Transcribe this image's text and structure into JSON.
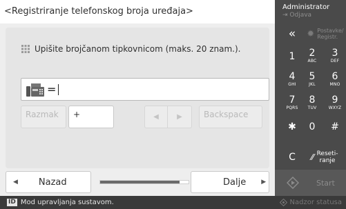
{
  "window": {
    "title": "<Registriranje telefonskog broja uređaja>"
  },
  "instruction": {
    "text": "Upišite brojčanom tipkovnicom (maks. 20 znam.)."
  },
  "number_field": {
    "prefix": "=",
    "value": ""
  },
  "keys": {
    "space_label": "Razmak",
    "plus_label": "+",
    "backspace_label": "Backspace"
  },
  "navigation": {
    "back_label": "Nazad",
    "next_label": "Dalje",
    "progress_fraction": 0.9
  },
  "sidebar": {
    "admin_label": "Administrator",
    "logout_label": "Odjava",
    "settings_label_line1": "Postavke/",
    "settings_label_line2": "Registr.",
    "reset_label_line1": "Reseti-",
    "reset_label_line2": "ranje",
    "start_label": "Start",
    "numpad": [
      {
        "digit": "1",
        "letters": ""
      },
      {
        "digit": "2",
        "letters": "ABC"
      },
      {
        "digit": "3",
        "letters": "DEF"
      },
      {
        "digit": "4",
        "letters": "GHI"
      },
      {
        "digit": "5",
        "letters": "JKL"
      },
      {
        "digit": "6",
        "letters": "MNO"
      },
      {
        "digit": "7",
        "letters": "PQRS"
      },
      {
        "digit": "8",
        "letters": "TUV"
      },
      {
        "digit": "9",
        "letters": "WXYZ"
      },
      {
        "digit": "✱",
        "letters": ""
      },
      {
        "digit": "0",
        "letters": ""
      },
      {
        "digit": "#",
        "letters": ""
      }
    ],
    "clear_label": "C"
  },
  "statusbar": {
    "id_badge": "ID",
    "message": "Mod upravljanja sustavom.",
    "status_monitor_label": "Nadzor statusa"
  },
  "colors": {
    "sidebar_bg": "#4a4a4a",
    "content_bg": "#eeeeee",
    "status_bg": "#3a3a3a"
  }
}
